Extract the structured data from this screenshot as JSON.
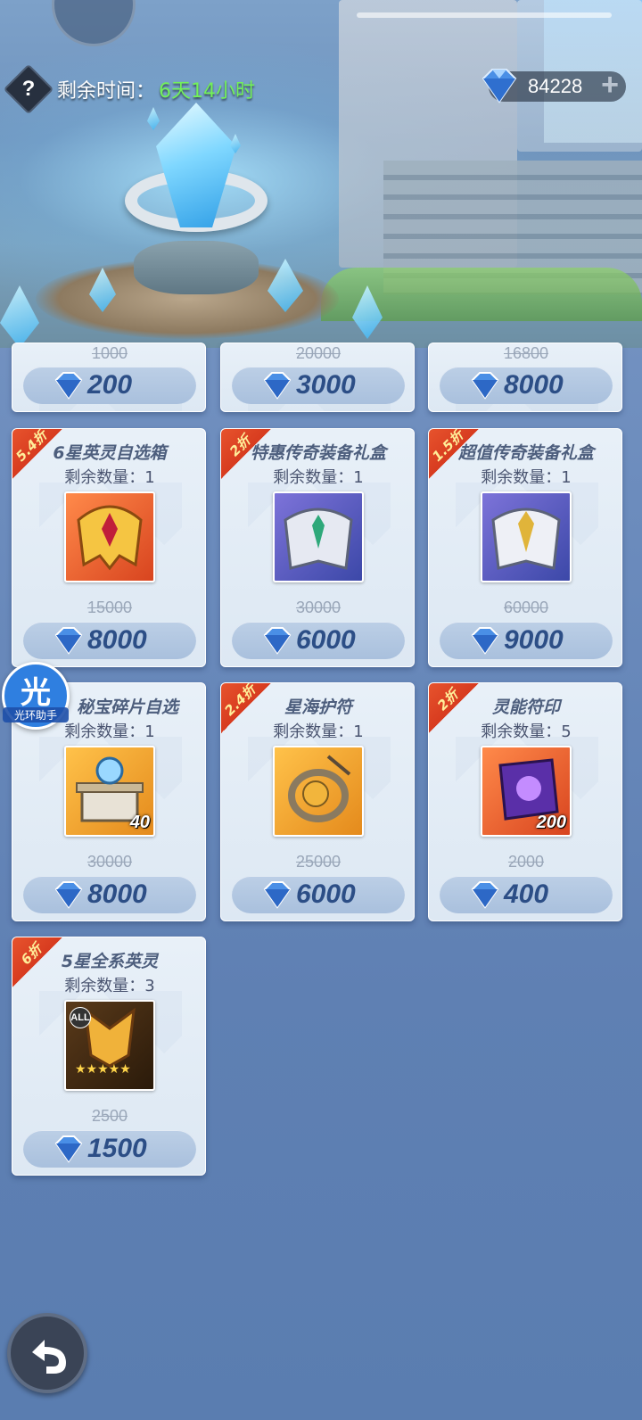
{
  "header": {
    "help_label": "?",
    "time_label": "剩余时间：",
    "time_value": "6天14小时",
    "currency_value": "84228",
    "currency_plus": "+"
  },
  "colors": {
    "time_value": "#73f05a",
    "ribbon": "#e8552e",
    "price_text": "#2c4e86",
    "card_bg": "#e8f0f8",
    "gem": "#3b7bd9"
  },
  "top_row": [
    {
      "original_price": "1000",
      "price": "200"
    },
    {
      "original_price": "20000",
      "price": "3000"
    },
    {
      "original_price": "16800",
      "price": "8000"
    }
  ],
  "items": [
    {
      "discount": "5.4折",
      "name": "6星英灵自选箱",
      "stock": "剩余数量：1",
      "icon": "golden-helmet-icon",
      "count": "",
      "original_price": "15000",
      "price": "8000"
    },
    {
      "discount": "2折",
      "name": "特惠传奇装备礼盒",
      "stock": "剩余数量：1",
      "icon": "silver-armor-icon",
      "count": "",
      "original_price": "30000",
      "price": "6000"
    },
    {
      "discount": "1.5折",
      "name": "超值传奇装备礼盒",
      "stock": "剩余数量：1",
      "icon": "gold-silver-armor-icon",
      "count": "",
      "original_price": "60000",
      "price": "9000"
    },
    {
      "discount": "",
      "name": "秘宝碎片自选",
      "stock": "剩余数量：1",
      "icon": "treasure-box-icon",
      "count": "40",
      "original_price": "30000",
      "price": "8000"
    },
    {
      "discount": "2.4折",
      "name": "星海护符",
      "stock": "剩余数量：1",
      "icon": "amulet-icon",
      "count": "",
      "original_price": "25000",
      "price": "6000"
    },
    {
      "discount": "2折",
      "name": "灵能符印",
      "stock": "剩余数量：5",
      "icon": "purple-crystal-icon",
      "count": "200",
      "original_price": "2000",
      "price": "400"
    },
    {
      "discount": "6折",
      "name": "5星全系英灵",
      "stock": "剩余数量：3",
      "icon": "five-star-mask-icon",
      "count": "",
      "original_price": "2500",
      "price": "1500",
      "all_badge": "ALL"
    }
  ],
  "helper": {
    "big": "光",
    "small": "光环助手"
  }
}
